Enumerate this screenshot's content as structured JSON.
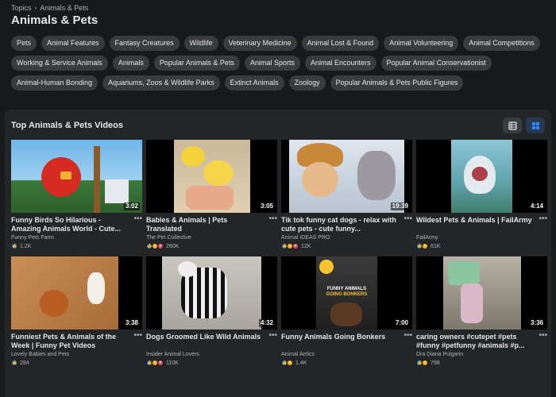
{
  "breadcrumb": {
    "root": "Topics",
    "current": "Animals & Pets"
  },
  "page_title": "Animals & Pets",
  "chips": [
    "Pets",
    "Animal Features",
    "Fantasy Creatures",
    "Wildlife",
    "Veterinary Medicine",
    "Animal Lost & Found",
    "Animal Volunteering",
    "Animal Competitions",
    "Working & Service Animals",
    "Animals",
    "Popular Animals & Pets",
    "Animal Sports",
    "Animal Encounters",
    "Popular Animal Conservationist",
    "Animal-Human Bonding",
    "Aquariums, Zoos & Wildlife Parks",
    "Extinct Animals",
    "Zoology",
    "Popular Animals & Pets Public Figures"
  ],
  "section": {
    "title": "Top Animals & Pets Videos",
    "list_icon": "list-view-icon",
    "grid_icon": "grid-view-icon"
  },
  "colors": {
    "background": "#18191a",
    "panel": "#242526",
    "chip": "#3a3b3c",
    "accent": "#1877f2"
  },
  "videos": [
    {
      "title": "Funny Birds So Hilarious - Amazing Animals World - Cute...",
      "channel": "Funny Pets Farm",
      "duration": "3:02",
      "reactions": [
        "like"
      ],
      "count": "1.2K"
    },
    {
      "title": "Babies & Animals | Pets Translated",
      "channel": "The Pet Collective",
      "duration": "3:05",
      "reactions": [
        "like",
        "haha",
        "love"
      ],
      "count": "260K"
    },
    {
      "title": "Tik tok funny cat dogs - relax with cute pets - cute funny...",
      "channel": "Animal IDEAS PRO",
      "duration": "19:39",
      "reactions": [
        "like",
        "haha",
        "love"
      ],
      "count": "12K"
    },
    {
      "title": "Wildest Pets & Animals | FailArmy",
      "channel": "FailArmy",
      "duration": "4:14",
      "reactions": [
        "like",
        "haha"
      ],
      "count": "61K"
    },
    {
      "title": "Funniest Pets & Animals of the Week | Funny Pet Videos",
      "channel": "Lovely Babies and Pets",
      "duration": "3:38",
      "reactions": [
        "like"
      ],
      "count": "284"
    },
    {
      "title": "Dogs Groomed Like Wild Animals",
      "channel": "Insider Animal Lovers",
      "duration": "4:32",
      "reactions": [
        "like",
        "wow",
        "love"
      ],
      "count": "110K"
    },
    {
      "title": "Funny Animals Going Bonkers",
      "channel": "Animal Antics",
      "duration": "7:00",
      "reactions": [
        "like",
        "haha"
      ],
      "count": "1.4K"
    },
    {
      "title": "caring owners #cutepet #pets #funny #petfunny #animals #p...",
      "channel": "Dra Diana Pulgarin",
      "duration": "3:36",
      "reactions": [
        "like",
        "haha"
      ],
      "count": "798"
    }
  ],
  "thumb_overlay_text": [
    "FUNNY ANIMALS",
    "GOING BONKERS"
  ]
}
